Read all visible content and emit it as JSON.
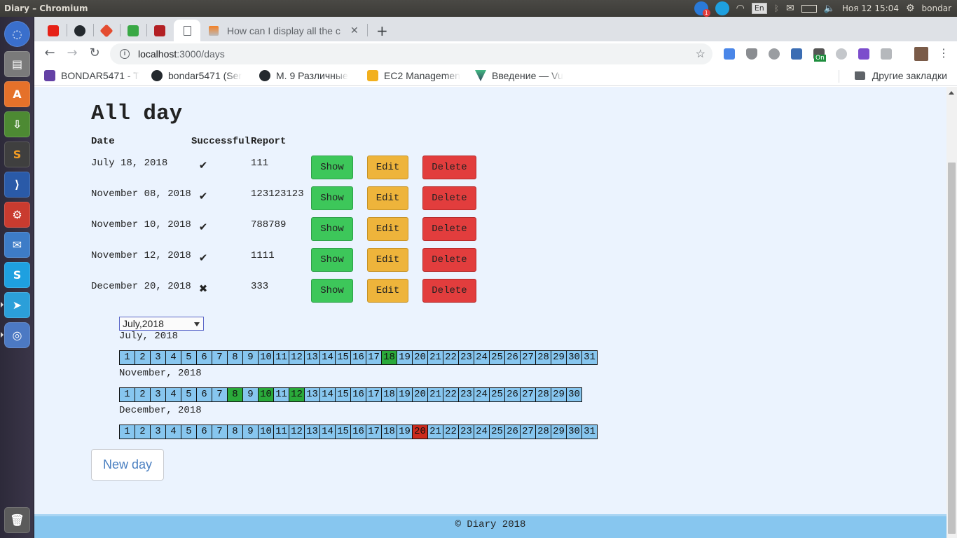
{
  "system_panel": {
    "window_title": "Diary – Chromium",
    "notification_count": "1",
    "keyboard_layout": "En",
    "datetime": "Ноя 12 15:04",
    "user": "bondar"
  },
  "browser": {
    "tabs": {
      "active_tab_icon": "blank-page-icon",
      "so_tab_title": "How can I display all the c",
      "close_glyph": "✕",
      "new_tab_glyph": "+"
    },
    "toolbar": {
      "back_glyph": "←",
      "forward_glyph": "→",
      "reload_glyph": "↻",
      "url_host": "localhost",
      "url_path": ":3000/days",
      "star_glyph": "☆",
      "extension_badge": "On"
    },
    "bookmarks": [
      {
        "label": "BONDAR5471 - T",
        "icon": "twitch-icon"
      },
      {
        "label": "bondar5471 (Ser",
        "icon": "github-icon"
      },
      {
        "label": "M. 9 Различные",
        "icon": "github-icon"
      },
      {
        "label": "EC2 Managemen",
        "icon": "aws-icon"
      },
      {
        "label": "Введение — Vu",
        "icon": "vue-icon"
      }
    ],
    "other_bookmarks": "Другие закладки"
  },
  "page": {
    "heading": "All day",
    "columns": [
      "Date",
      "Successful",
      "Report"
    ],
    "buttons": {
      "show": "Show",
      "edit": "Edit",
      "delete": "Delete"
    },
    "rows": [
      {
        "date": "July 18, 2018",
        "successful": "✔",
        "report": "111"
      },
      {
        "date": "November 08, 2018",
        "successful": "✔",
        "report": "123123123"
      },
      {
        "date": "November 10, 2018",
        "successful": "✔",
        "report": "788789"
      },
      {
        "date": "November 12, 2018",
        "successful": "✔",
        "report": "1111"
      },
      {
        "date": "December 20, 2018",
        "successful": "✖",
        "report": "333"
      }
    ],
    "month_select": {
      "selected": "July,2018"
    },
    "calendars": [
      {
        "label": "July, 2018",
        "days": 31,
        "success_days": [
          18
        ],
        "fail_days": []
      },
      {
        "label": "November, 2018",
        "days": 30,
        "success_days": [
          8,
          10,
          12
        ],
        "fail_days": []
      },
      {
        "label": "December, 2018",
        "days": 31,
        "success_days": [],
        "fail_days": [
          20
        ]
      }
    ],
    "new_day_button": "New day",
    "footer": "© Diary 2018"
  },
  "colors": {
    "page_background": "#ebf3fe",
    "show_button": "#3dc75a",
    "edit_button": "#eeb43b",
    "delete_button": "#e23d3d",
    "day_default": "#87c6ef",
    "day_success": "#2aaa3a",
    "day_fail": "#cc2b1e",
    "footer": "#87c6ef"
  }
}
